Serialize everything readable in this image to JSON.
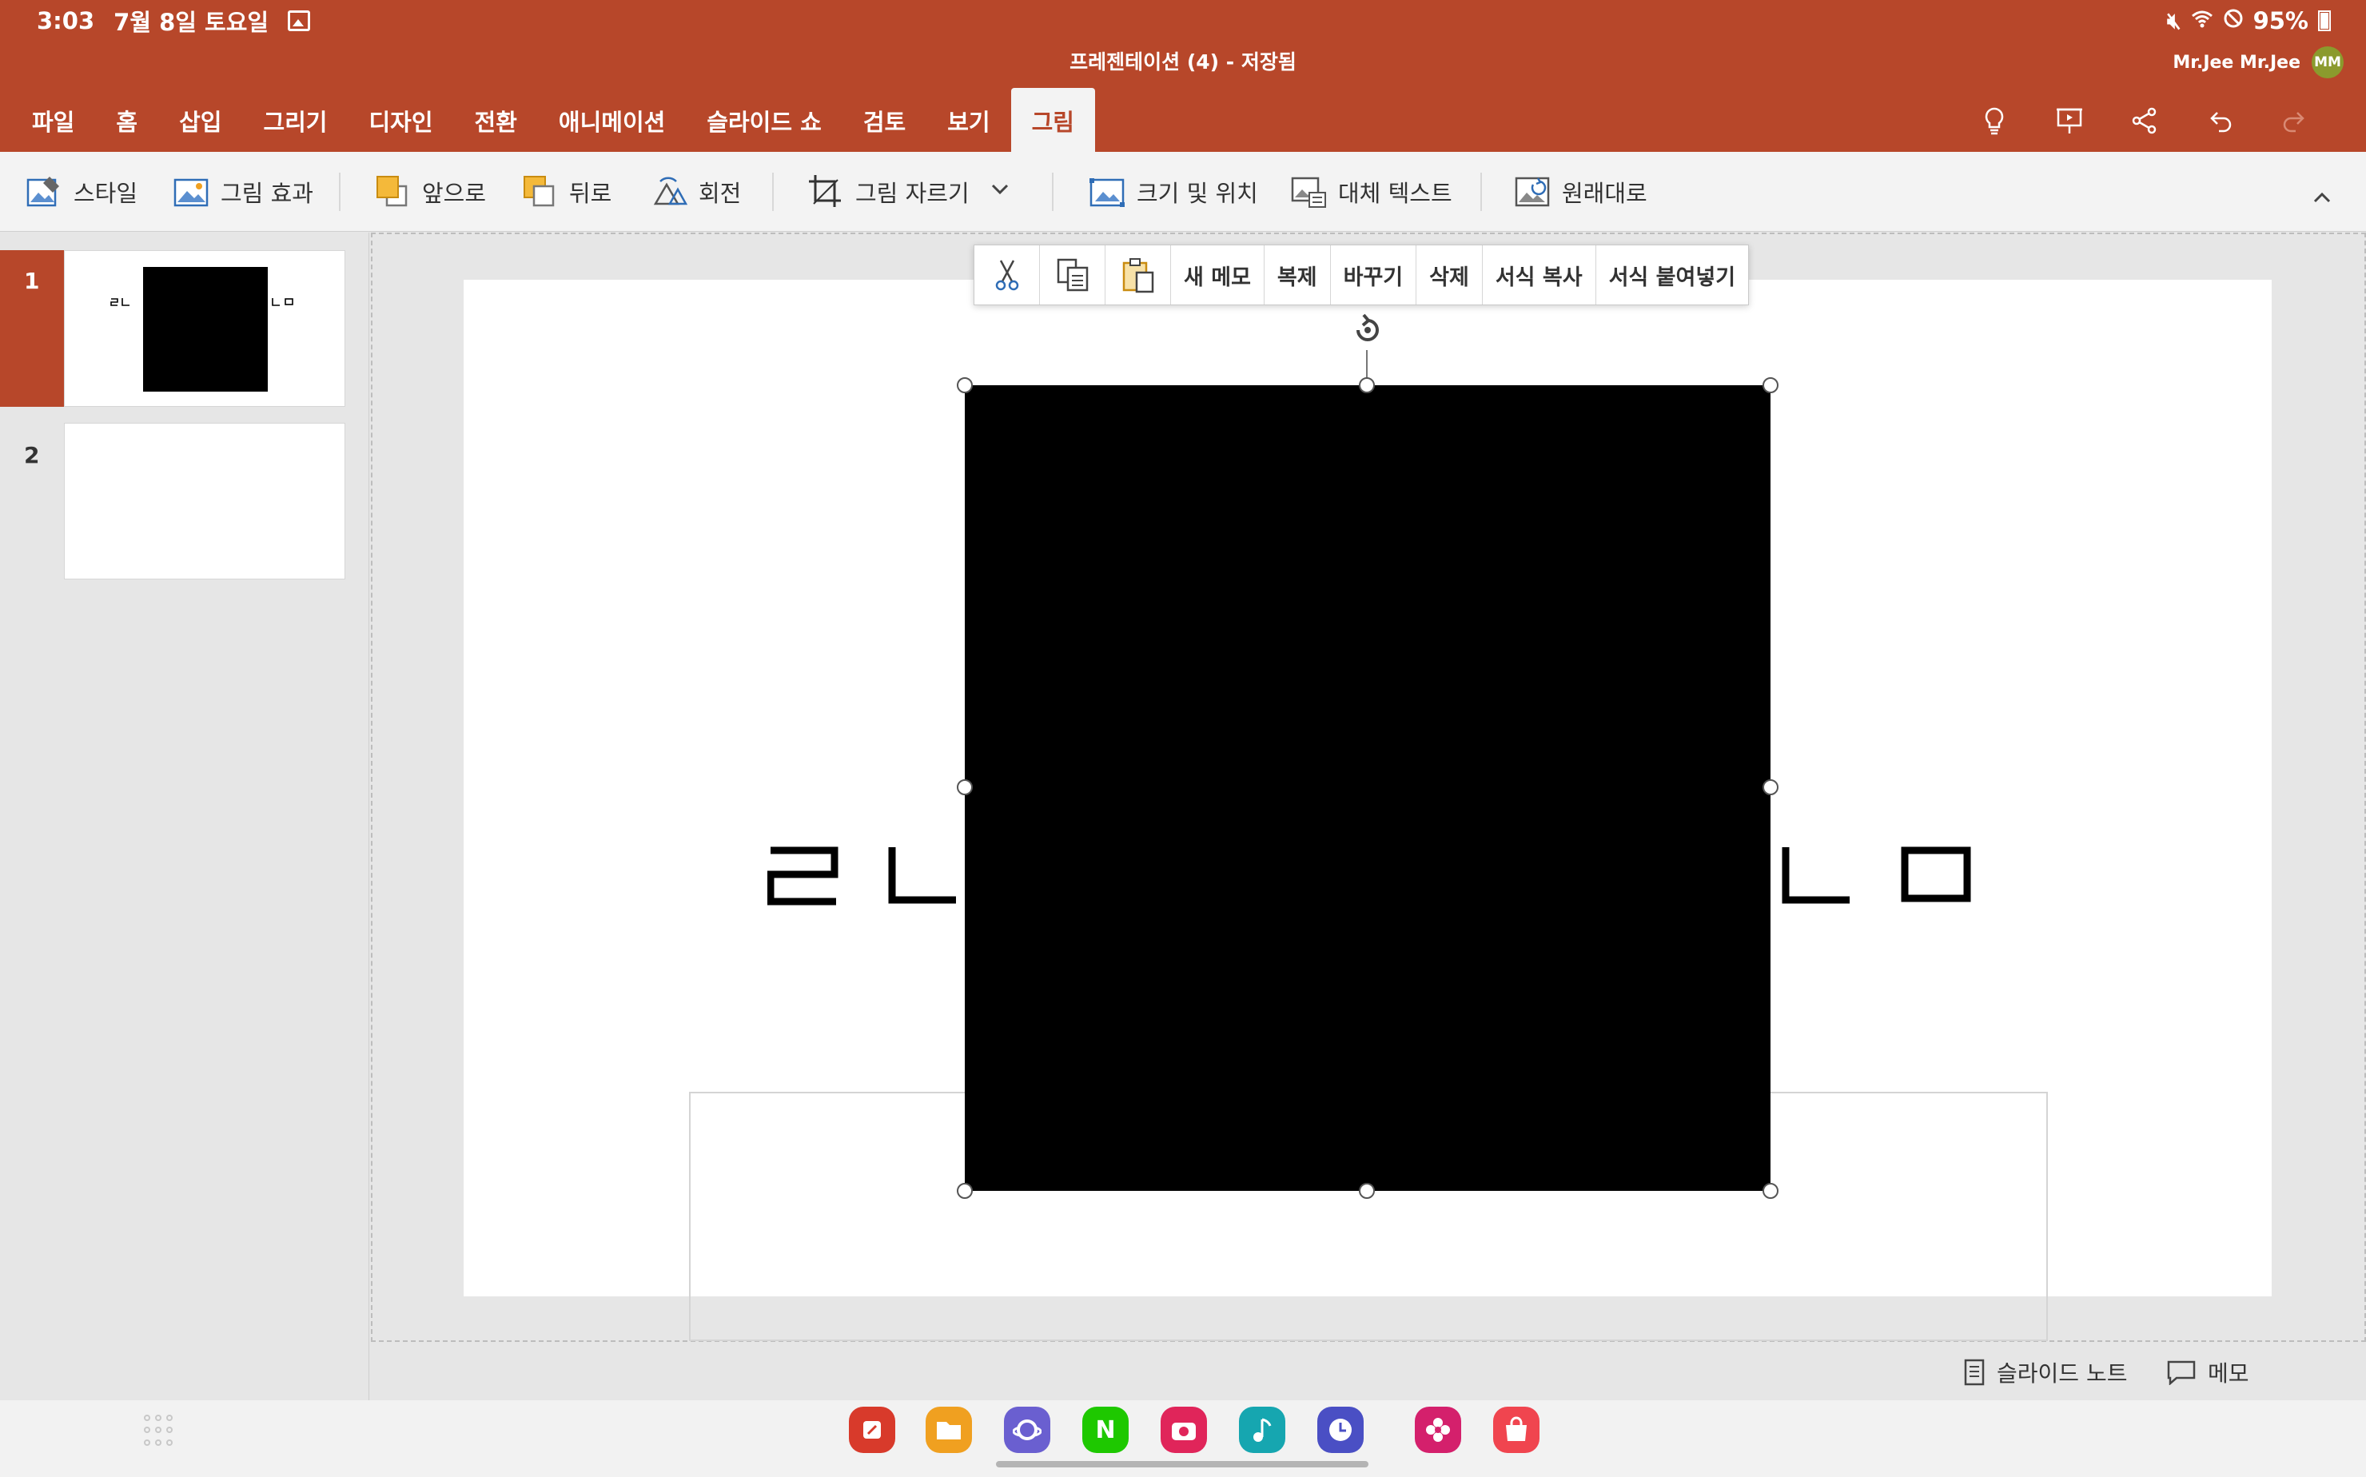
{
  "status_bar": {
    "time": "3:03",
    "date": "7월 8일 토요일",
    "battery": "95%",
    "icons": [
      "gallery-notification-icon",
      "mute-icon",
      "wifi-icon",
      "do-not-disturb-icon",
      "battery-icon"
    ]
  },
  "app_bar": {
    "document_title": "프레젠테이션 (4) - 저장됨",
    "user_name": "Mr.Jee Mr.Jee",
    "avatar_initials": "MM",
    "accent_color": "#b7472a"
  },
  "tabs": [
    {
      "label": "파일"
    },
    {
      "label": "홈"
    },
    {
      "label": "삽입"
    },
    {
      "label": "그리기"
    },
    {
      "label": "디자인"
    },
    {
      "label": "전환"
    },
    {
      "label": "애니메이션"
    },
    {
      "label": "슬라이드 쇼"
    },
    {
      "label": "검토"
    },
    {
      "label": "보기"
    },
    {
      "label": "그림",
      "active": true
    }
  ],
  "quick_actions": [
    "lightbulb-icon",
    "present-icon",
    "share-icon",
    "undo-icon",
    "redo-icon"
  ],
  "ribbon": {
    "style": "스타일",
    "picture_effects": "그림 효과",
    "bring_forward": "앞으로",
    "send_backward": "뒤로",
    "rotate": "회전",
    "crop": "그림 자르기",
    "size_position": "크기 및 위치",
    "alt_text": "대체 텍스트",
    "reset": "원래대로"
  },
  "slides": [
    {
      "number": "1",
      "selected": true
    },
    {
      "number": "2",
      "selected": false
    }
  ],
  "slide_content": {
    "left_letters": [
      "ㄹ",
      "ㄴ"
    ],
    "right_letters": [
      "ㄴ",
      "ㅁ"
    ]
  },
  "context_menu": {
    "new_comment": "새 메모",
    "duplicate": "복제",
    "replace": "바꾸기",
    "delete": "삭제",
    "copy_format": "서식 복사",
    "paste_format": "서식 붙여넣기"
  },
  "bottom_bar": {
    "notes": "슬라이드 노트",
    "comments": "메모"
  },
  "dock_apps": [
    {
      "name": "notes-app-icon",
      "color": "#d83a2b"
    },
    {
      "name": "files-app-icon",
      "color": "#f0a020"
    },
    {
      "name": "internet-app-icon",
      "color": "#6a5fd0"
    },
    {
      "name": "naver-app-icon",
      "color": "#1ec800"
    },
    {
      "name": "camera-app-icon",
      "color": "#e0255a"
    },
    {
      "name": "music-app-icon",
      "color": "#16a6b0"
    },
    {
      "name": "clock-app-icon",
      "color": "#4a4fc4"
    },
    {
      "name": "flower-app-icon",
      "color": "#d4206c"
    },
    {
      "name": "store-app-icon",
      "color": "#f0454f"
    }
  ]
}
